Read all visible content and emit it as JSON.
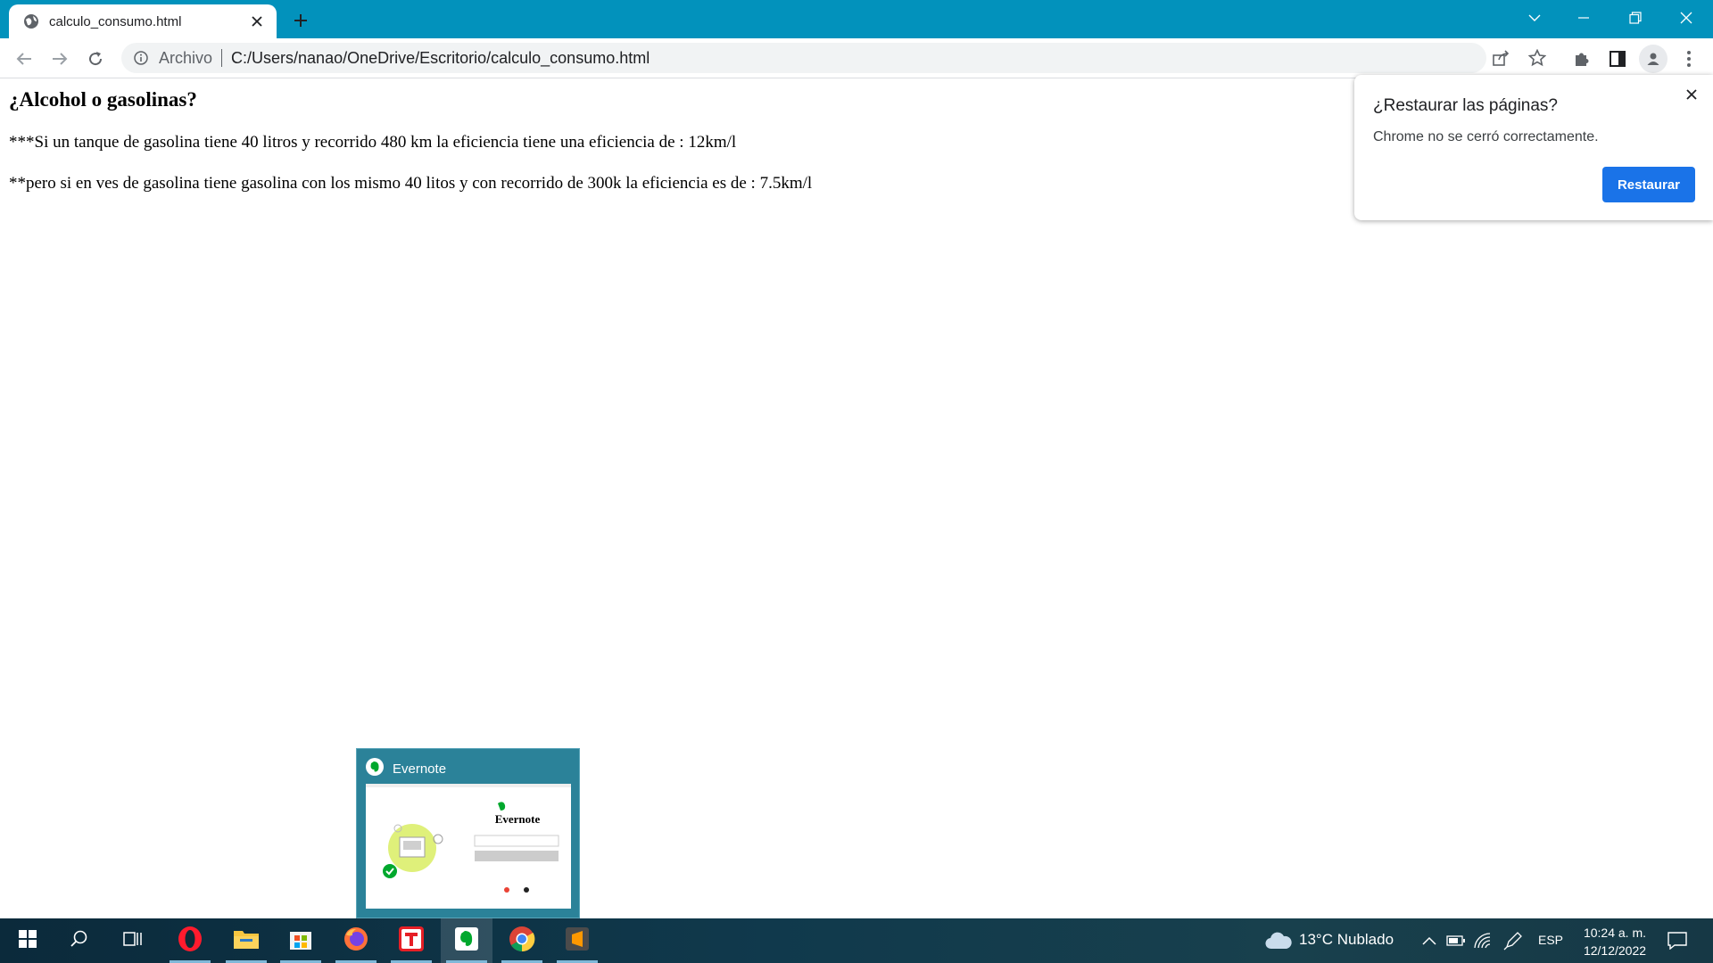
{
  "browser": {
    "tab": {
      "title": "calculo_consumo.html"
    },
    "address_bar": {
      "scheme_label": "Archivo",
      "url": "C:/Users/nanao/OneDrive/Escritorio/calculo_consumo.html"
    },
    "accent_color": "#0292bc"
  },
  "page": {
    "heading": "¿Alcohol o gasolinas?",
    "paragraphs": [
      "***Si un tanque de gasolina tiene 40 litros y recorrido 480 km la eficiencia tiene una eficiencia de : 12km/l",
      "**pero si en ves de gasolina tiene gasolina con los mismo 40 litos y con recorrido de 300k la eficiencia es de : 7.5km/l"
    ]
  },
  "restore_bubble": {
    "title": "¿Restaurar las páginas?",
    "message": "Chrome no se cerró correctamente.",
    "button_label": "Restaurar",
    "button_color": "#1a73e8"
  },
  "taskbar_preview": {
    "app_name": "Evernote",
    "thumbnail_brand": "Evernote"
  },
  "taskbar": {
    "apps": [
      {
        "name": "Opera",
        "icon": "opera-icon"
      },
      {
        "name": "File Explorer",
        "icon": "folder-icon"
      },
      {
        "name": "Microsoft Store",
        "icon": "store-icon"
      },
      {
        "name": "Firefox",
        "icon": "firefox-icon"
      },
      {
        "name": "T app",
        "icon": "t-app-icon"
      },
      {
        "name": "Evernote",
        "icon": "evernote-icon"
      },
      {
        "name": "Chrome",
        "icon": "chrome-icon"
      },
      {
        "name": "Sublime Text",
        "icon": "sublime-icon"
      }
    ],
    "weather": "13°C  Nublado",
    "language": "ESP",
    "time": "10:24 a. m.",
    "date": "12/12/2022"
  }
}
